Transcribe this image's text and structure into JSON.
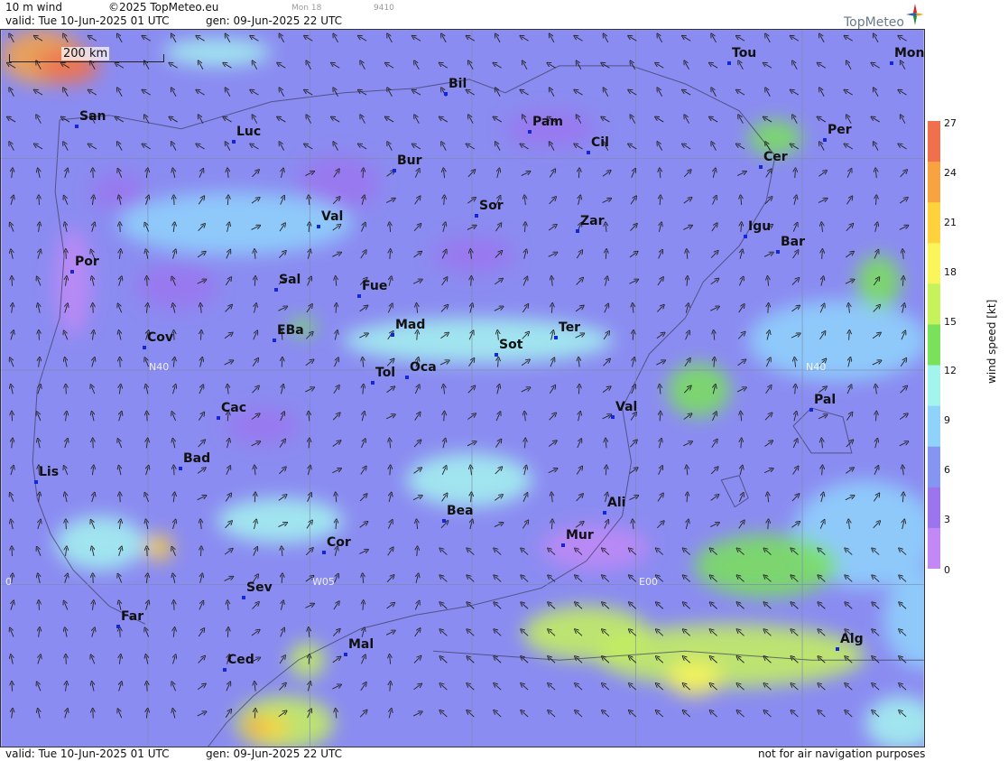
{
  "header": {
    "product": "10 m wind",
    "copyright": "©2025 TopMeteo.eu",
    "valid": "valid:  Tue  10-Jun-2025  01 UTC",
    "gen": "gen: 09-Jun-2025 22 UTC",
    "faint1": "Mon 18",
    "faint2": "9410",
    "logo": "TopMeteo"
  },
  "footer": {
    "valid": "valid:  Tue  10-Jun-2025  01 UTC",
    "gen": "gen: 09-Jun-2025 22 UTC",
    "note": "not for air navigation purposes"
  },
  "scale": "200 km",
  "legend": {
    "title": "wind speed  [kt]",
    "ticks": [
      "27",
      "24",
      "21",
      "18",
      "15",
      "12",
      "9",
      "6",
      "3",
      "0"
    ],
    "colors": [
      "#f0704e",
      "#f7a342",
      "#fdd23c",
      "#f9f55b",
      "#c6f25c",
      "#79e25a",
      "#a4f4ee",
      "#8fd3fb",
      "#8596f2",
      "#9b75ee",
      "#c188f6"
    ]
  },
  "grid_labels": {
    "n40_west": "N40",
    "n40_east": "N40",
    "w05": "W05",
    "e00": "E00",
    "left0": "0"
  },
  "cities": [
    {
      "name": "Tou"
    },
    {
      "name": "Mon"
    },
    {
      "name": "Bil"
    },
    {
      "name": "San"
    },
    {
      "name": "Luc"
    },
    {
      "name": "Pam"
    },
    {
      "name": "Per"
    },
    {
      "name": "Cil"
    },
    {
      "name": "Cer"
    },
    {
      "name": "Bur"
    },
    {
      "name": "Sor"
    },
    {
      "name": "Val"
    },
    {
      "name": "Zar"
    },
    {
      "name": "Igu"
    },
    {
      "name": "Bar"
    },
    {
      "name": "Por"
    },
    {
      "name": "Sal"
    },
    {
      "name": "Fue"
    },
    {
      "name": "Mad"
    },
    {
      "name": "Ter"
    },
    {
      "name": "Cov"
    },
    {
      "name": "EBa"
    },
    {
      "name": "Sot"
    },
    {
      "name": "Tol"
    },
    {
      "name": "Oca"
    },
    {
      "name": "Val"
    },
    {
      "name": "Pal"
    },
    {
      "name": "Cac"
    },
    {
      "name": "Bad"
    },
    {
      "name": "Lis"
    },
    {
      "name": "Ali"
    },
    {
      "name": "Bea"
    },
    {
      "name": "Mur"
    },
    {
      "name": "Cor"
    },
    {
      "name": "Sev"
    },
    {
      "name": "Far"
    },
    {
      "name": "Mal"
    },
    {
      "name": "Alg"
    },
    {
      "name": "Ced"
    }
  ]
}
